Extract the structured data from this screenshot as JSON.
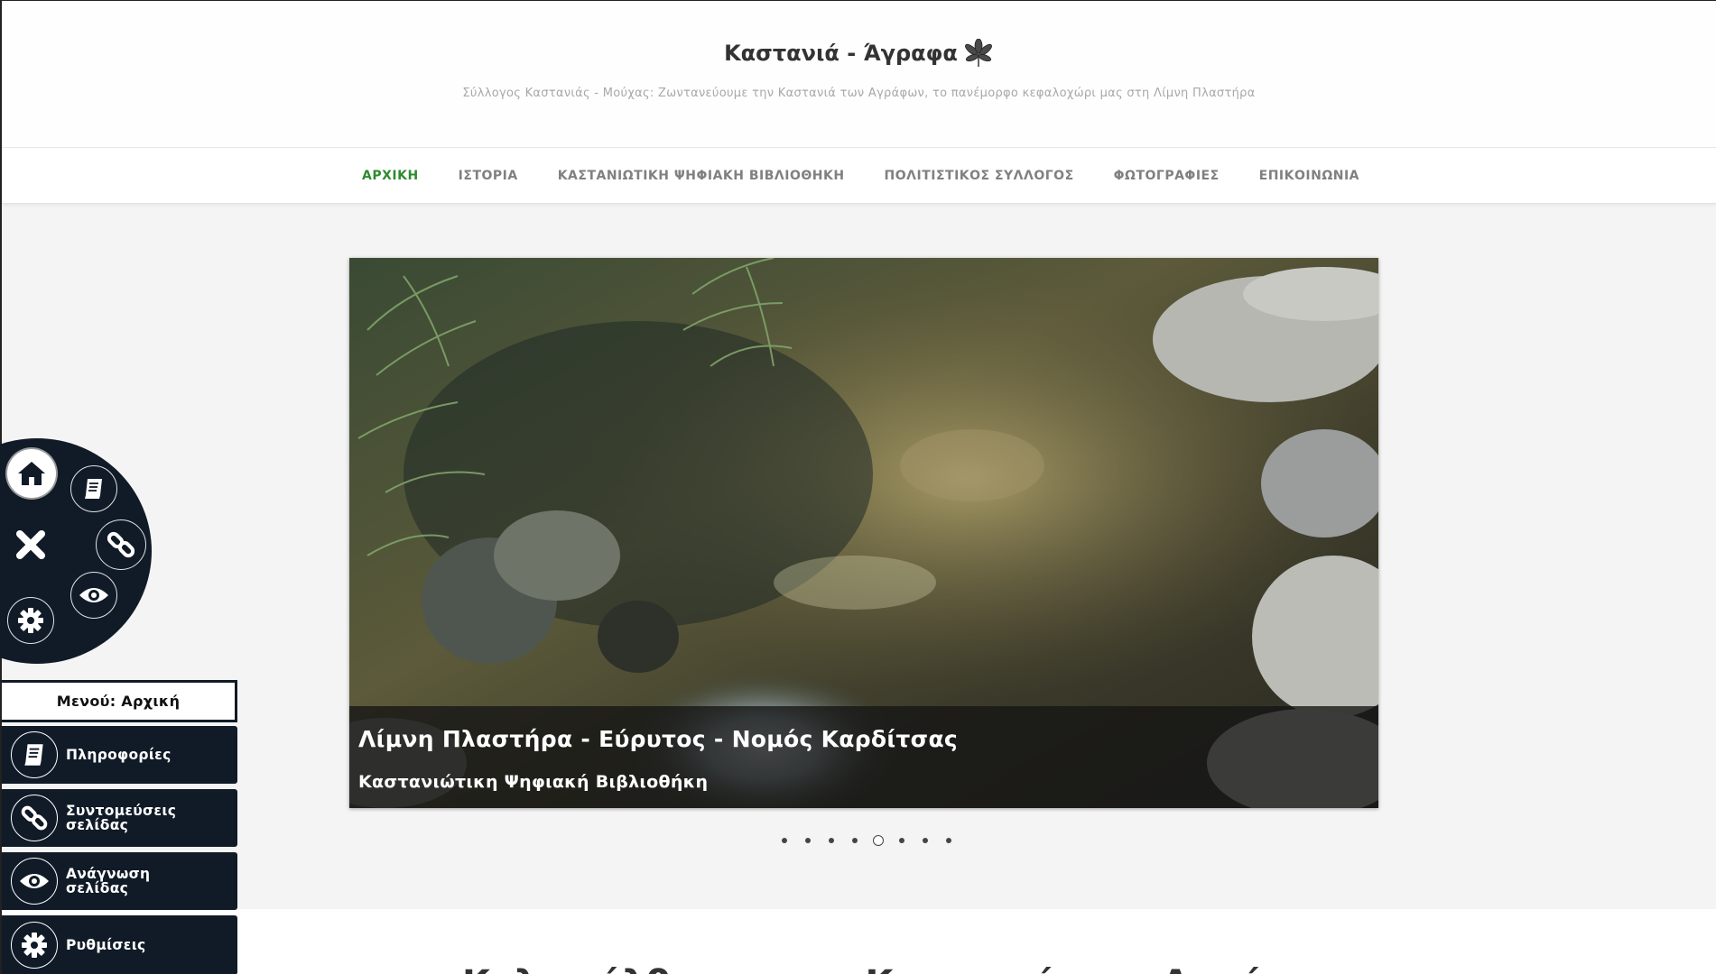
{
  "header": {
    "title": "Καστανιά - Άγραφα",
    "tagline": "Σύλλογος Καστανιάς - Μούχας: Ζωντανεύουμε την Καστανιά των Αγράφων, το πανέμορφο κεφαλοχώρι μας στη Λίμνη Πλαστήρα",
    "logo_icon": "chestnut-leaf-icon"
  },
  "nav": {
    "items": [
      {
        "label": "ΑΡΧΙΚΗ",
        "active": true
      },
      {
        "label": "ΙΣΤΟΡΙΑ",
        "active": false
      },
      {
        "label": "ΚΑΣΤΑΝΙΩΤΙΚΗ ΨΗΦΙΑΚΗ ΒΙΒΛΙΟΘΗΚΗ",
        "active": false
      },
      {
        "label": "ΠΟΛΙΤΙΣΤΙΚΟΣ ΣΥΛΛΟΓΟΣ",
        "active": false
      },
      {
        "label": "ΦΩΤΟΓΡΑΦΙΕΣ",
        "active": false
      },
      {
        "label": "ΕΠΙΚΟΙΝΩΝΙΑ",
        "active": false
      }
    ],
    "active_color": "#2f8a2f",
    "inactive_color": "#808080"
  },
  "slider": {
    "caption_title": "Λίμνη Πλαστήρα - Εύρυτος - Νομός Καρδίτσας",
    "caption_subtitle": "Καστανιώτικη Ψηφιακή Βιβλιοθήκη",
    "slide_count": 8,
    "active_slide": 5
  },
  "content": {
    "heading": "Καλωσήλθατε στην Καστανιά των Αγράφων"
  },
  "accessibility": {
    "wheel_icons": [
      "home-icon",
      "book-icon",
      "close-icon",
      "link-icon",
      "eye-icon",
      "gear-icon"
    ],
    "menu_title": "Μενού: Αρχική",
    "items": [
      {
        "label": "Πληροφορίες",
        "icon": "book-icon"
      },
      {
        "label": "Συντομεύσεις σελίδας",
        "icon": "link-icon"
      },
      {
        "label": "Ανάγνωση σελίδας",
        "icon": "eye-icon"
      },
      {
        "label": "Ρυθμίσεις",
        "icon": "gear-icon"
      }
    ],
    "panel_color": "#111b27"
  }
}
